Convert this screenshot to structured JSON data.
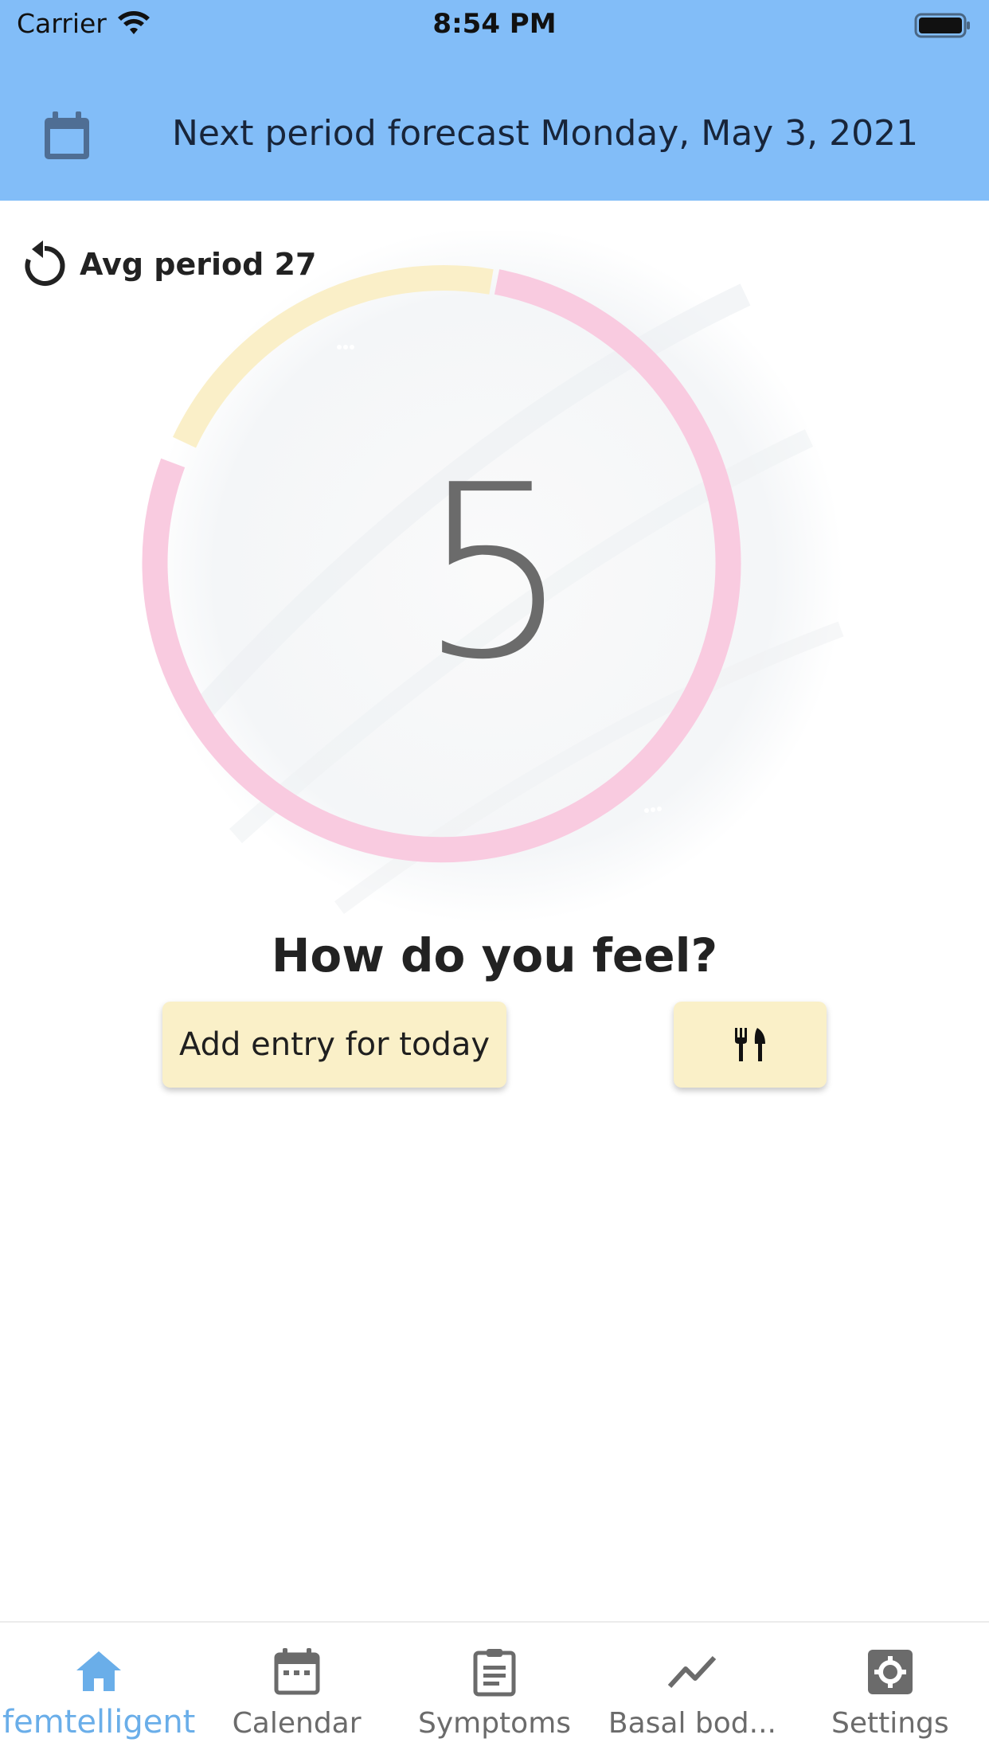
{
  "status_bar": {
    "carrier": "Carrier",
    "time": "8:54 PM"
  },
  "header": {
    "forecast_text": "Next period forecast Monday, May 3, 2021",
    "calendar_icon": "calendar-icon"
  },
  "cycle": {
    "avg_label": "Avg period 27",
    "day_number": "5",
    "colors": {
      "period_segment": "#f9cbe0",
      "fertile_segment": "#faefc8"
    }
  },
  "main": {
    "question": "How do you feel?",
    "add_entry_label": "Add entry for today",
    "food_icon": "restaurant-icon"
  },
  "bottom_nav": {
    "items": [
      {
        "label": "femtelligent",
        "icon": "home-icon",
        "active": true
      },
      {
        "label": "Calendar",
        "icon": "calendar-icon",
        "active": false
      },
      {
        "label": "Symptoms",
        "icon": "clipboard-icon",
        "active": false
      },
      {
        "label": "Basal bod...",
        "icon": "trending-icon",
        "active": false
      },
      {
        "label": "Settings",
        "icon": "gear-icon",
        "active": false
      }
    ]
  },
  "theme": {
    "header_color": "#82bdf8",
    "button_color": "#faf0c8",
    "active_nav_color": "#6aaee9"
  }
}
